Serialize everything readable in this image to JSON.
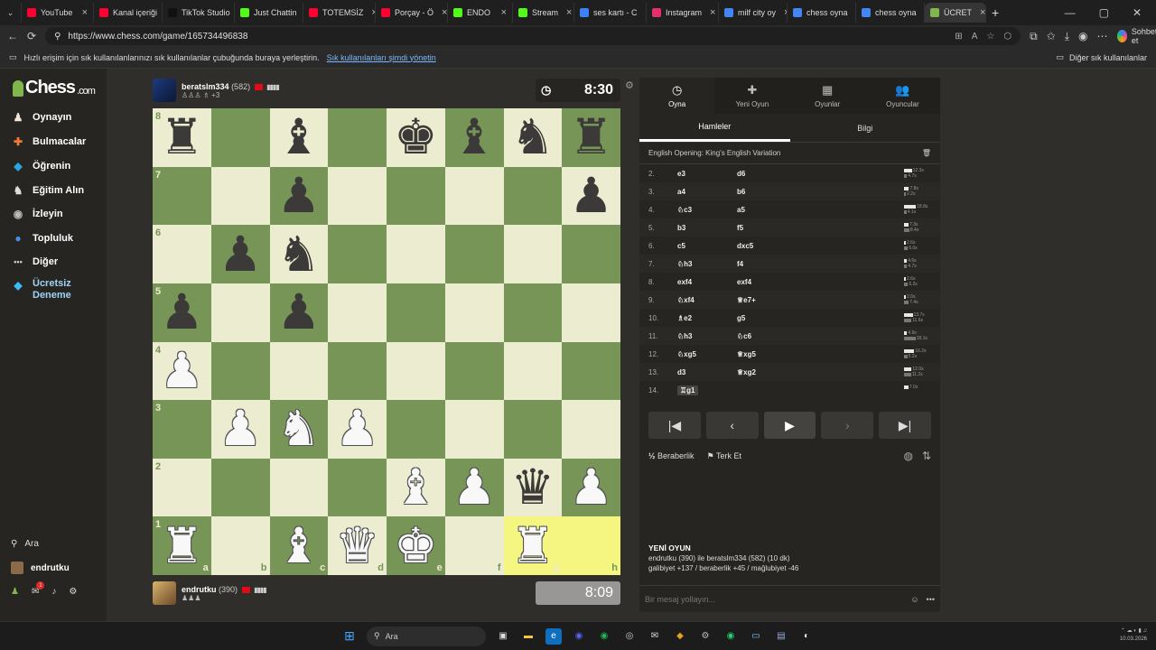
{
  "browser": {
    "tabs": [
      {
        "label": "YouTube",
        "color": "#ff0033"
      },
      {
        "label": "Kanal içeriği",
        "color": "#ff0033"
      },
      {
        "label": "TikTok Studio",
        "color": "#111111"
      },
      {
        "label": "Just Chattin",
        "color": "#53fc18"
      },
      {
        "label": "TOTEMSİZ",
        "color": "#ff0033"
      },
      {
        "label": "Porçay - Ö",
        "color": "#ff0033"
      },
      {
        "label": "ENDO",
        "color": "#53fc18"
      },
      {
        "label": "Stream",
        "color": "#53fc18"
      },
      {
        "label": "ses kartı - C",
        "color": "#3b82f6"
      },
      {
        "label": "Instagram",
        "color": "#e1306c"
      },
      {
        "label": "milf city oy",
        "color": "#4285f4"
      },
      {
        "label": "chess oyna",
        "color": "#4285f4"
      },
      {
        "label": "chess oyna",
        "color": "#4285f4"
      },
      {
        "label": "ÜCRET",
        "color": "#81b64c"
      }
    ],
    "url": "https://www.chess.com/game/165734496838",
    "copilot_label": "Sohbet et",
    "bookmarks_hint": "Hızlı erişim için sık kullanılanlarınızı sık kullanılanlar çubuğunda buraya yerleştirin.",
    "bookmarks_link": "Sık kullanılanları şimdi yönetin",
    "other_bookmarks": "Diğer sık kullanılanlar"
  },
  "nav": {
    "logo": "Chess",
    "logo_suffix": ".com",
    "items": [
      {
        "label": "Oynayın",
        "icon": "play-icon",
        "glyph": "♟",
        "color": "#f0e6d2"
      },
      {
        "label": "Bulmacalar",
        "icon": "puzzle-icon",
        "glyph": "✚",
        "color": "#f07a2e"
      },
      {
        "label": "Öğrenin",
        "icon": "learn-icon",
        "glyph": "◆",
        "color": "#2aa7e0"
      },
      {
        "label": "Eğitim Alın",
        "icon": "coach-icon",
        "glyph": "♞",
        "color": "#dddddd"
      },
      {
        "label": "İzleyin",
        "icon": "watch-icon",
        "glyph": "◉",
        "color": "#bbbbbb"
      },
      {
        "label": "Topluluk",
        "icon": "community-icon",
        "glyph": "●",
        "color": "#4a90e2"
      },
      {
        "label": "Diğer",
        "icon": "more-icon",
        "glyph": "•••",
        "color": "#cccccc"
      }
    ],
    "premium": "Ücretsiz Deneme",
    "search": "Ara",
    "username": "endrutku",
    "notif_count": "1"
  },
  "top_player": {
    "name": "beratslm334",
    "rating": "(582)",
    "sub": "+3",
    "clock": "8:30"
  },
  "bottom_player": {
    "name": "endrutku",
    "rating": "(390)",
    "clock": "8:09"
  },
  "board": {
    "files": [
      "a",
      "b",
      "c",
      "d",
      "e",
      "f",
      "g",
      "h"
    ],
    "ranks": [
      "8",
      "7",
      "6",
      "5",
      "4",
      "3",
      "2",
      "1"
    ],
    "position": [
      [
        "r",
        "",
        "b",
        "",
        "k",
        "b",
        "n",
        "r"
      ],
      [
        "",
        "",
        "p",
        "",
        "",
        "",
        "",
        "p"
      ],
      [
        "",
        "p",
        "n",
        "",
        "",
        "",
        "",
        ""
      ],
      [
        "p",
        "",
        "p",
        "",
        "",
        "",
        "",
        ""
      ],
      [
        "P",
        "",
        "",
        "",
        "",
        "",
        "",
        ""
      ],
      [
        "",
        "P",
        "N",
        "P",
        "",
        "",
        "",
        ""
      ],
      [
        "",
        "",
        "",
        "",
        "B",
        "P",
        "q",
        "P"
      ],
      [
        "R",
        "",
        "B",
        "Q",
        "K",
        "",
        "R",
        ""
      ]
    ],
    "highlight": [
      "g1",
      "h1"
    ]
  },
  "panel": {
    "tabs": [
      {
        "label": "Oyna",
        "icon": "clock-icon",
        "glyph": "◷"
      },
      {
        "label": "Yeni Oyun",
        "icon": "new-game-icon",
        "glyph": "✚"
      },
      {
        "label": "Oyunlar",
        "icon": "games-icon",
        "glyph": "▦"
      },
      {
        "label": "Oyuncular",
        "icon": "players-icon",
        "glyph": "👥"
      }
    ],
    "subtabs": [
      "Hamleler",
      "Bilgi"
    ],
    "opening": "English Opening: King's English Variation",
    "moves": [
      {
        "no": "2.",
        "w": "e3",
        "b": "d6",
        "tw": "12.3s",
        "tb": "4.7s"
      },
      {
        "no": "3.",
        "w": "a4",
        "b": "b6",
        "tw": "7.8s",
        "tb": "2.2s"
      },
      {
        "no": "4.",
        "w": "♘c3",
        "b": "a5",
        "tw": "18.8s",
        "tb": "4.1s"
      },
      {
        "no": "5.",
        "w": "b3",
        "b": "f5",
        "tw": "7.3s",
        "tb": "8.4s"
      },
      {
        "no": "6.",
        "w": "c5",
        "b": "dxc5",
        "tw": "2.6s",
        "tb": "6.0s"
      },
      {
        "no": "7.",
        "w": "♘h3",
        "b": "f4",
        "tw": "4.6s",
        "tb": "4.7s"
      },
      {
        "no": "8.",
        "w": "exf4",
        "b": "exf4",
        "tw": "2.6s",
        "tb": "6.2s"
      },
      {
        "no": "9.",
        "w": "♘xf4",
        "b": "♕e7+",
        "tw": "2.0s",
        "tb": "7.4s"
      },
      {
        "no": "10.",
        "w": "♗e2",
        "b": "g5",
        "tw": "13.7s",
        "tb": "11.6s"
      },
      {
        "no": "11.",
        "w": "♘h3",
        "b": "♘c6",
        "tw": "4.9s",
        "tb": "18.1s"
      },
      {
        "no": "12.",
        "w": "♘xg5",
        "b": "♕xg5",
        "tw": "16.2s",
        "tb": "5.2s"
      },
      {
        "no": "13.",
        "w": "d3",
        "b": "♕xg2",
        "tw": "12.0s",
        "tb": "11.2s"
      },
      {
        "no": "14.",
        "w": "♖g1",
        "b": "",
        "tw": "7.0s",
        "tb": ""
      }
    ],
    "draw": "Beraberlik",
    "resign": "Terk Et",
    "newgame_title": "YENİ OYUN",
    "newgame_line1": "endrutku (390) ile beratslm334 (582) (10 dk)",
    "newgame_line2": "galibiyet +137 / beraberlik +45 / mağlubiyet -46",
    "chat_placeholder": "Bir mesaj yollayın..."
  },
  "taskbar": {
    "search": "Ara",
    "date": "10.03.2026"
  },
  "colors": {
    "light_square": "#ebecd0",
    "dark_square": "#779556",
    "highlight": "#f5f682",
    "accent": "#81b64c"
  }
}
